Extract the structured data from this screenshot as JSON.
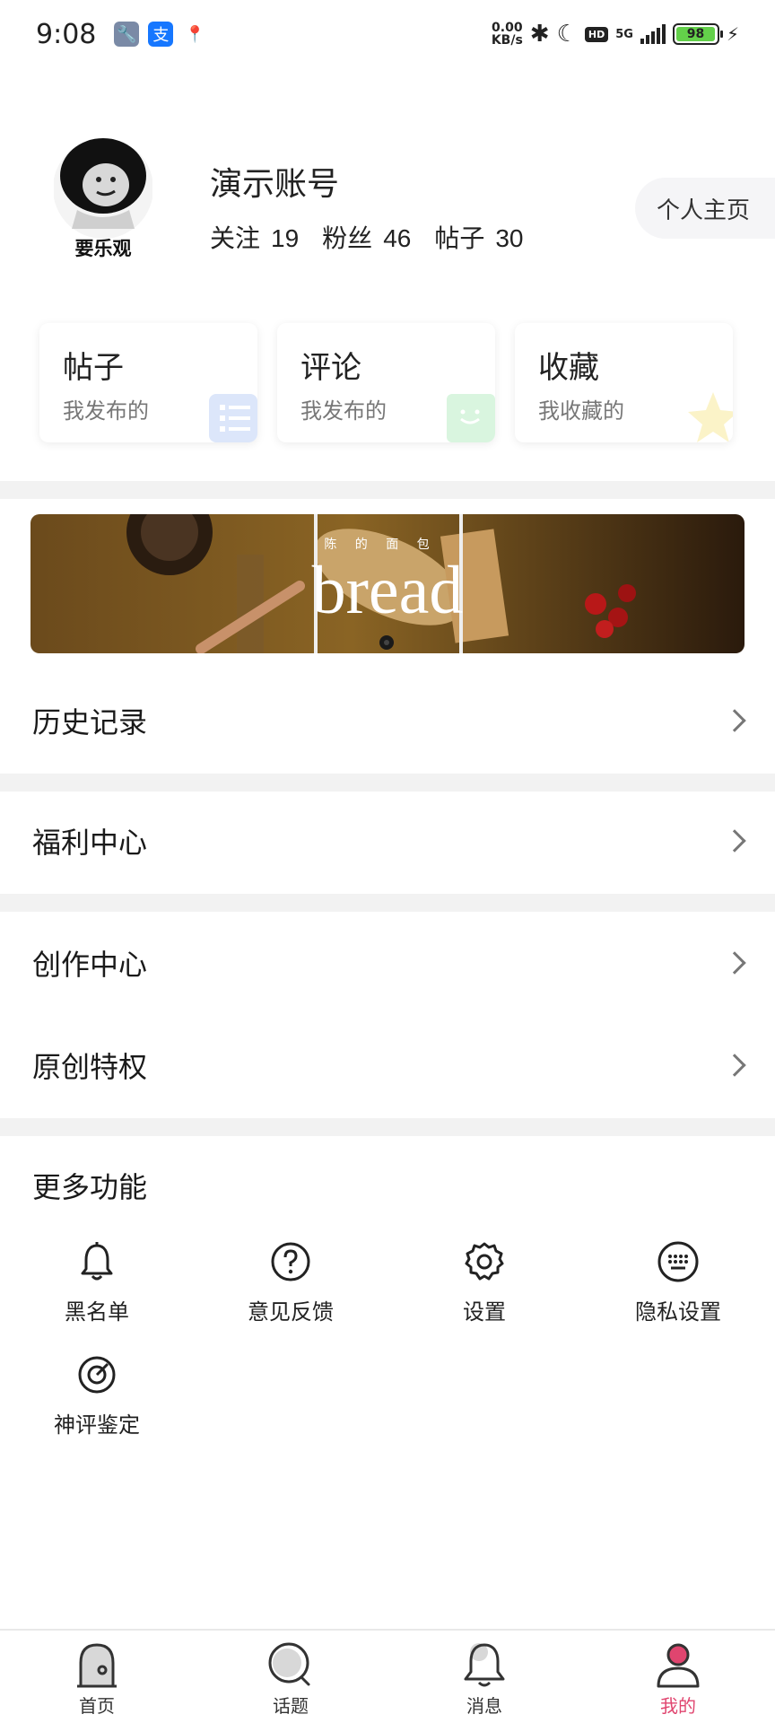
{
  "status": {
    "time": "9:08",
    "net_speed_value": "0.00",
    "net_speed_unit": "KB/s",
    "hd": "HD",
    "network": "5G",
    "battery": "98",
    "battery_level": 0.98
  },
  "profile": {
    "avatar_caption": "要乐观",
    "name": "演示账号",
    "stats": [
      {
        "label": "关注",
        "value": "19"
      },
      {
        "label": "粉丝",
        "value": "46"
      },
      {
        "label": "帖子",
        "value": "30"
      }
    ],
    "home_button": "个人主页"
  },
  "cards": [
    {
      "title": "帖子",
      "subtitle": "我发布的",
      "icon": "list-icon",
      "color": "#dce6fa"
    },
    {
      "title": "评论",
      "subtitle": "我发布的",
      "icon": "smile-icon",
      "color": "#d9f5df"
    },
    {
      "title": "收藏",
      "subtitle": "我收藏的",
      "icon": "star-icon",
      "color": "#fbf3c8"
    }
  ],
  "banner": {
    "headline": "bread",
    "brand_line": "陈 的 面 包"
  },
  "menu": {
    "history": "历史记录",
    "welfare": "福利中心",
    "creation": "创作中心",
    "original": "原创特权"
  },
  "more": {
    "title": "更多功能",
    "items": [
      {
        "label": "黑名单",
        "icon": "bell-icon"
      },
      {
        "label": "意见反馈",
        "icon": "help-circle-icon"
      },
      {
        "label": "设置",
        "icon": "gear-icon"
      },
      {
        "label": "隐私设置",
        "icon": "keyboard-icon"
      },
      {
        "label": "神评鉴定",
        "icon": "target-icon"
      }
    ]
  },
  "tabs": [
    {
      "label": "首页",
      "icon": "home-icon"
    },
    {
      "label": "话题",
      "icon": "topic-icon"
    },
    {
      "label": "消息",
      "icon": "message-bell-icon"
    },
    {
      "label": "我的",
      "icon": "profile-icon",
      "active": true
    }
  ],
  "colors": {
    "accent": "#e0456f",
    "band": "#f2f2f2"
  }
}
